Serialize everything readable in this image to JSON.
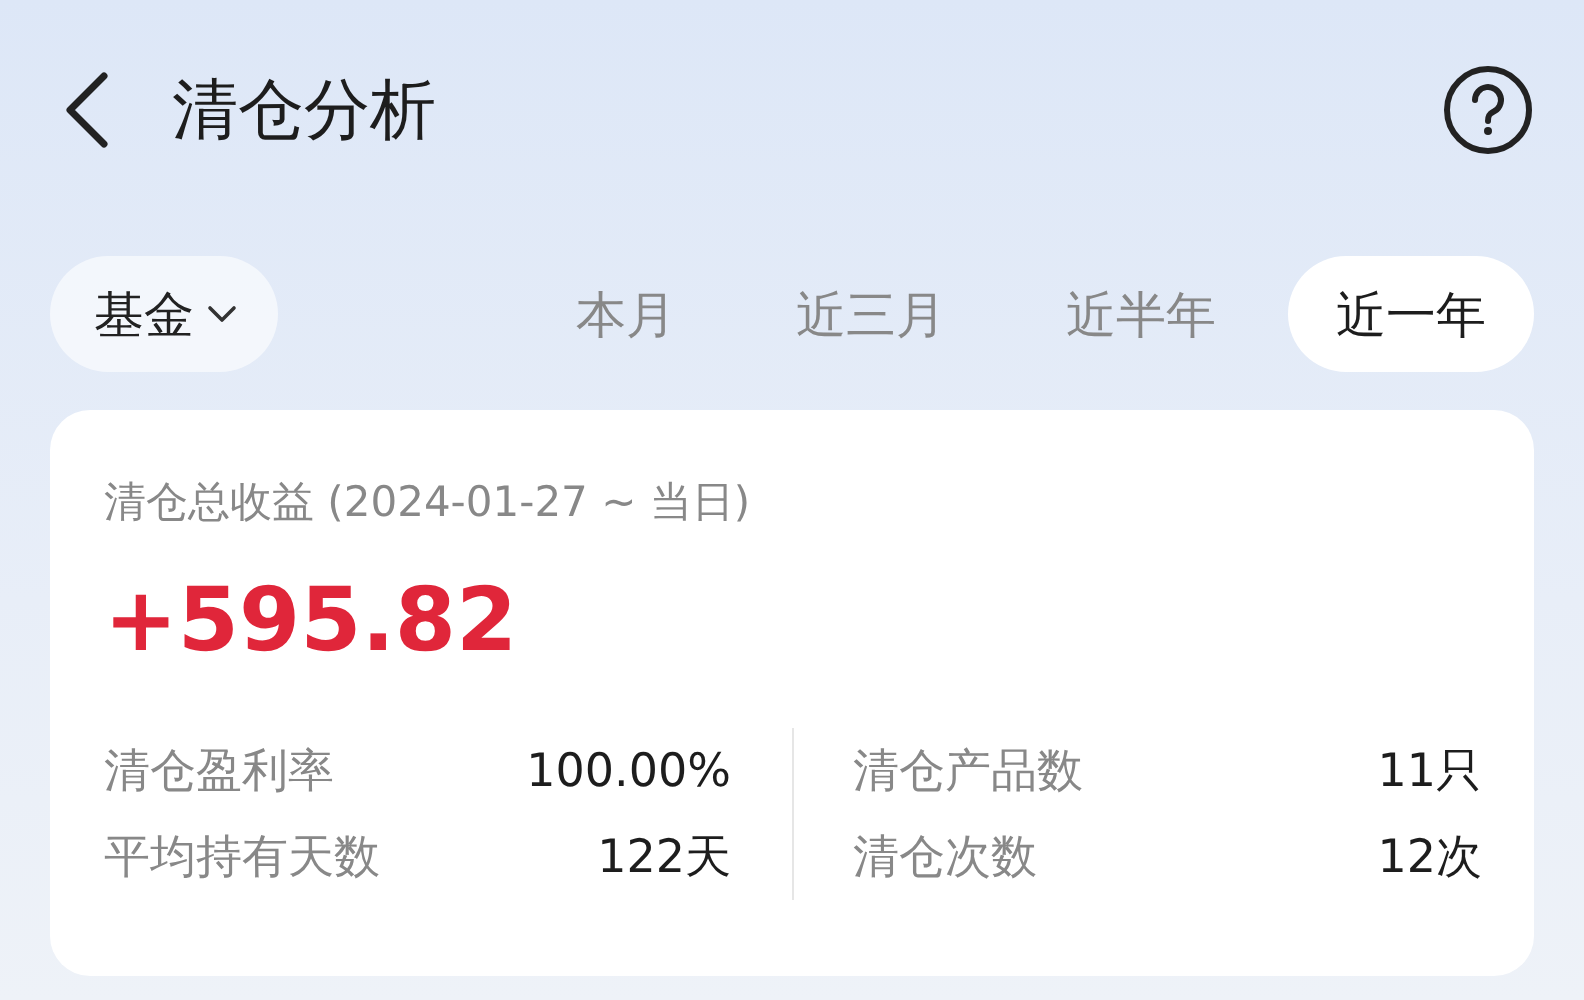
{
  "header": {
    "title": "清仓分析"
  },
  "filter": {
    "category": "基金",
    "periods": [
      {
        "label": "本月",
        "selected": false
      },
      {
        "label": "近三月",
        "selected": false
      },
      {
        "label": "近半年",
        "selected": false
      },
      {
        "label": "近一年",
        "selected": true
      }
    ]
  },
  "summary": {
    "label": "清仓总收益 (2024-01-27 ~ 当日)",
    "value": "+595.82"
  },
  "stats": [
    {
      "label": "清仓盈利率",
      "value": "100.00%"
    },
    {
      "label": "清仓产品数",
      "value": "11只"
    },
    {
      "label": "平均持有天数",
      "value": "122天"
    },
    {
      "label": "清仓次数",
      "value": "12次"
    }
  ]
}
